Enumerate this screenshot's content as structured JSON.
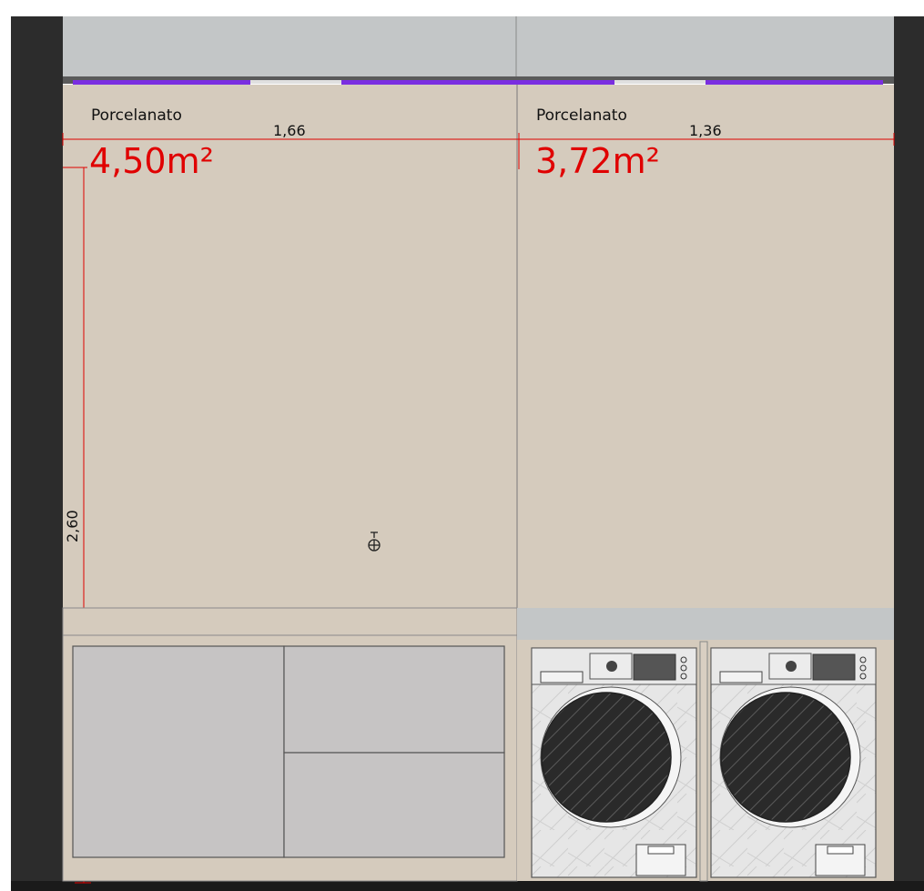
{
  "walls": [
    {
      "material": "Porcelanato",
      "width": "1,66",
      "area": "4,50m²"
    },
    {
      "material": "Porcelanato",
      "width": "1,36",
      "area": "3,72m²"
    }
  ],
  "height_dim": "2,60",
  "colors": {
    "wall_tile": "#d5cbbd",
    "upper_wall": "#c3c6c7",
    "dark_frame": "#2c2c2c",
    "dimension_red": "#e00000",
    "window_strip": "#7a2ee0",
    "cabinet": "#c6c4c4",
    "countertop": "#d5cbbd"
  },
  "icons": [
    "faucet-icon",
    "washing-machine-icon",
    "dryer-icon"
  ]
}
